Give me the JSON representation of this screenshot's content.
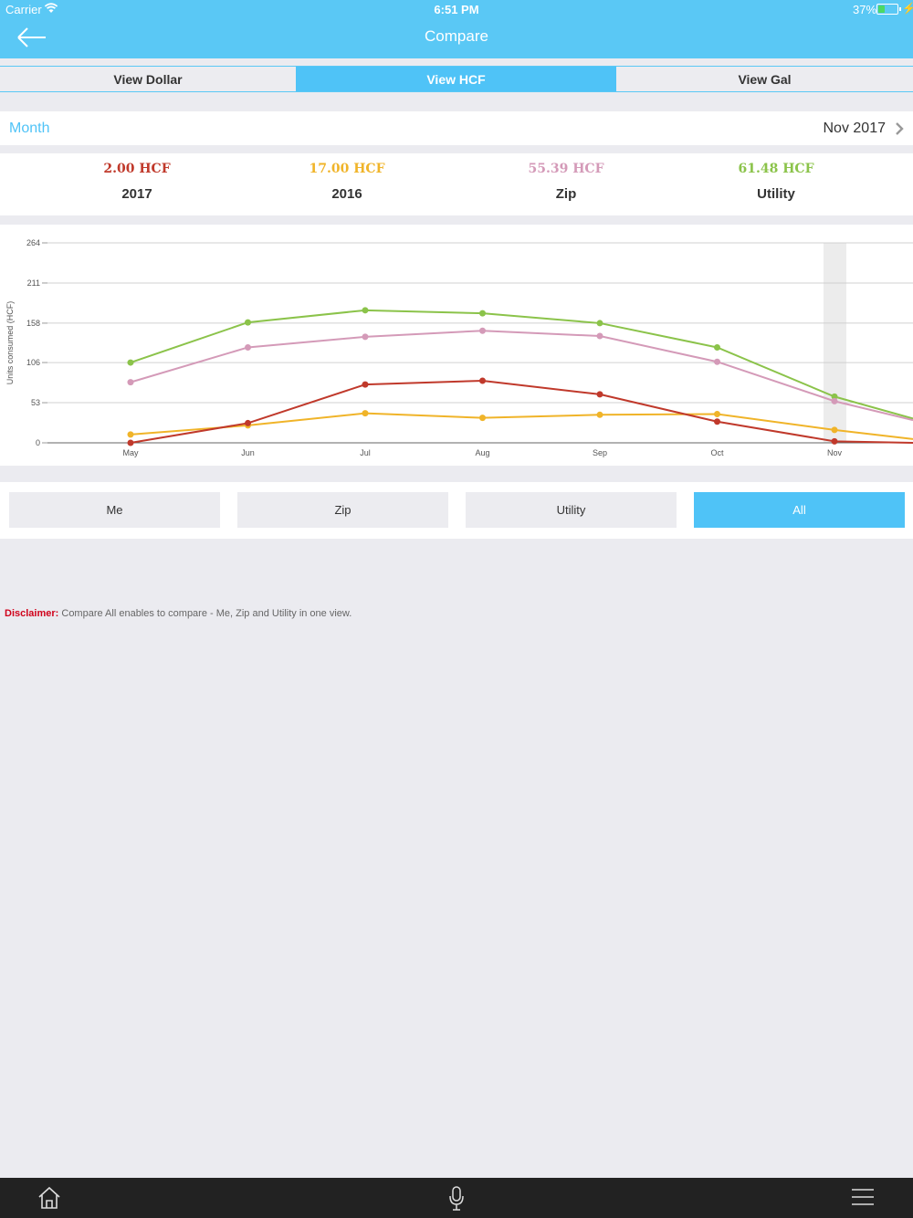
{
  "status": {
    "carrier": "Carrier",
    "time": "6:51 PM",
    "battery": "37%",
    "battery_level": 0.37
  },
  "nav": {
    "title": "Compare"
  },
  "segments": [
    {
      "label": "View Dollar",
      "selected": false
    },
    {
      "label": "View HCF",
      "selected": true
    },
    {
      "label": "View Gal",
      "selected": false
    }
  ],
  "period": {
    "label": "Month",
    "value": "Nov 2017"
  },
  "summary": [
    {
      "value": "2.00 HCF",
      "name": "2017",
      "color": "#c0392b"
    },
    {
      "value": "17.00 HCF",
      "name": "2016",
      "color": "#f0b429"
    },
    {
      "value": "55.39 HCF",
      "name": "Zip",
      "color": "#d49ab8"
    },
    {
      "value": "61.48 HCF",
      "name": "Utility",
      "color": "#8bc34a"
    }
  ],
  "chart_data": {
    "type": "line",
    "ylabel": "Units consumed (HCF)",
    "yticks": [
      "0",
      "53",
      "106",
      "158",
      "211",
      "264"
    ],
    "ylim": [
      0,
      264
    ],
    "categories": [
      "May",
      "Jun",
      "Jul",
      "Aug",
      "Sep",
      "Oct",
      "Nov"
    ],
    "highlight_category": "Nov",
    "grid": true,
    "series": [
      {
        "name": "Utility",
        "color": "#8bc34a",
        "values": [
          106,
          159,
          175,
          171,
          158,
          126,
          61
        ],
        "trail": 32
      },
      {
        "name": "Zip",
        "color": "#d49ab8",
        "values": [
          80,
          126,
          140,
          148,
          141,
          107,
          55
        ],
        "trail": 30
      },
      {
        "name": "2016",
        "color": "#f0b429",
        "values": [
          11,
          23,
          39,
          33,
          37,
          38,
          17
        ],
        "trail": 5
      },
      {
        "name": "2017",
        "color": "#c0392b",
        "values": [
          0,
          26,
          77,
          82,
          64,
          28,
          2
        ],
        "trail": 0
      }
    ]
  },
  "filters": [
    {
      "label": "Me",
      "selected": false
    },
    {
      "label": "Zip",
      "selected": false
    },
    {
      "label": "Utility",
      "selected": false
    },
    {
      "label": "All",
      "selected": true
    }
  ],
  "disclaimer": {
    "label": "Disclaimer:",
    "text": " Compare All enables to compare - Me, Zip and Utility in one view."
  },
  "tabbar": {
    "icons": [
      "home-icon",
      "microphone-icon",
      "menu-icon"
    ]
  }
}
